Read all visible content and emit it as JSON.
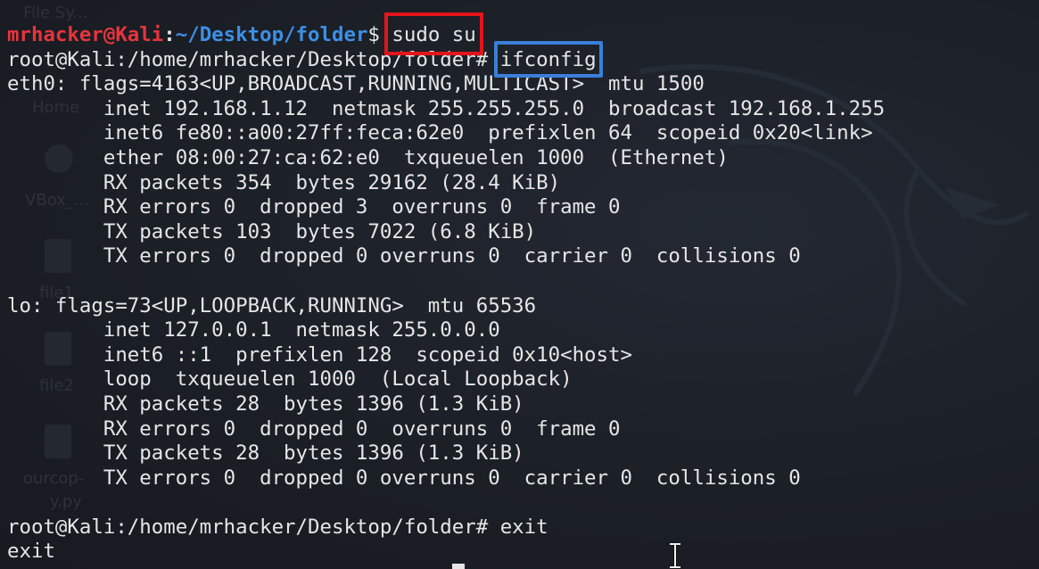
{
  "desktop": {
    "icons": [
      {
        "label": "File Sy..."
      },
      {
        "label": "Home"
      },
      {
        "label": "VBox_..."
      },
      {
        "label": "file1"
      },
      {
        "label": "file2"
      },
      {
        "label": "ourcop-"
      },
      {
        "label": "y.py"
      }
    ]
  },
  "terminal": {
    "prompt1": {
      "user": "mrhacker@Kali",
      "sep": ":",
      "path": "~/Desktop/folder",
      "symbol": "$ ",
      "command": "sudo su"
    },
    "prompt2": {
      "text": "root@Kali:/home/mrhacker/Desktop/folder# ",
      "command": "ifconfig"
    },
    "output": [
      "eth0: flags=4163<UP,BROADCAST,RUNNING,MULTICAST>  mtu 1500",
      "        inet 192.168.1.12  netmask 255.255.255.0  broadcast 192.168.1.255",
      "        inet6 fe80::a00:27ff:feca:62e0  prefixlen 64  scopeid 0x20<link>",
      "        ether 08:00:27:ca:62:e0  txqueuelen 1000  (Ethernet)",
      "        RX packets 354  bytes 29162 (28.4 KiB)",
      "        RX errors 0  dropped 3  overruns 0  frame 0",
      "        TX packets 103  bytes 7022 (6.8 KiB)",
      "        TX errors 0  dropped 0 overruns 0  carrier 0  collisions 0",
      "",
      "lo: flags=73<UP,LOOPBACK,RUNNING>  mtu 65536",
      "        inet 127.0.0.1  netmask 255.0.0.0",
      "        inet6 ::1  prefixlen 128  scopeid 0x10<host>",
      "        loop  txqueuelen 1000  (Local Loopback)",
      "        RX packets 28  bytes 1396 (1.3 KiB)",
      "        RX errors 0  dropped 0  overruns 0  frame 0",
      "        TX packets 28  bytes 1396 (1.3 KiB)",
      "        TX errors 0  dropped 0 overruns 0  carrier 0  collisions 0",
      ""
    ],
    "prompt3": {
      "text": "root@Kali:/home/mrhacker/Desktop/folder# ",
      "command": "exit"
    },
    "final_output": "exit"
  },
  "colors": {
    "background": "#1b1f26",
    "user": "#e8343c",
    "path": "#3d8fe6",
    "text": "#e6e6e6",
    "highlight_red": "#e3141b",
    "highlight_blue": "#3a7fd9"
  }
}
